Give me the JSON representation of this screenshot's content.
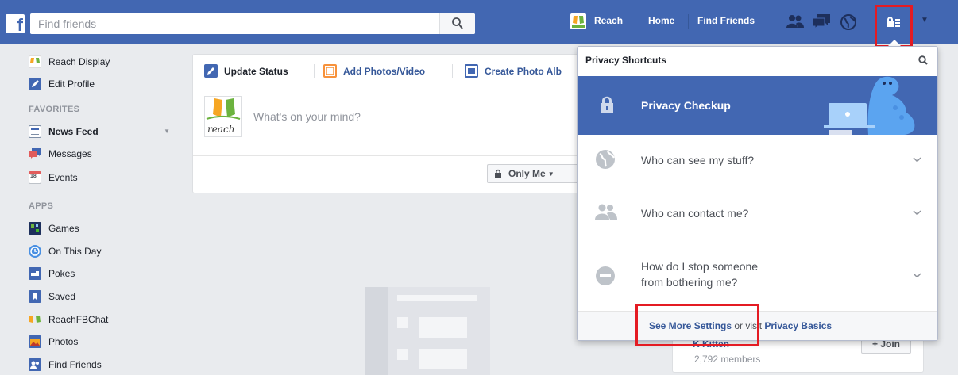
{
  "topbar": {
    "logo_letter": "f",
    "search_placeholder": "Find friends",
    "nav": {
      "profile_label": "Reach",
      "home_label": "Home",
      "find_friends_label": "Find Friends"
    },
    "icons": [
      "friend-requests-icon",
      "messages-icon",
      "notifications-globe-icon",
      "privacy-shortcuts-icon",
      "account-menu-caret-icon"
    ],
    "brand_color": "#4267b2"
  },
  "sidebar": {
    "top_items": [
      {
        "label": "Reach Display",
        "icon": "reach-logo-icon"
      },
      {
        "label": "Edit Profile",
        "icon": "pencil-icon"
      }
    ],
    "favorites_heading": "FAVORITES",
    "favorites": [
      {
        "label": "News Feed",
        "icon": "news-feed-icon",
        "bold": true
      },
      {
        "label": "Messages",
        "icon": "messages-icon"
      },
      {
        "label": "Events",
        "icon": "calendar-icon",
        "badge": "18"
      }
    ],
    "apps_heading": "APPS",
    "apps": [
      {
        "label": "Games",
        "icon": "games-icon"
      },
      {
        "label": "On This Day",
        "icon": "clock-icon"
      },
      {
        "label": "Pokes",
        "icon": "poke-icon"
      },
      {
        "label": "Saved",
        "icon": "bookmark-icon"
      },
      {
        "label": "ReachFBChat",
        "icon": "reach-logo-icon"
      },
      {
        "label": "Photos",
        "icon": "photos-icon"
      },
      {
        "label": "Find Friends",
        "icon": "find-friends-icon"
      }
    ]
  },
  "composer": {
    "tabs": [
      {
        "label": "Update Status",
        "icon": "pencil-icon"
      },
      {
        "label": "Add Photos/Video",
        "icon": "photo-icon"
      },
      {
        "label": "Create Photo Alb",
        "icon": "album-icon"
      }
    ],
    "avatar_text": "reach",
    "placeholder": "What's on your mind?",
    "audience_label": "Only Me"
  },
  "privacy_dropdown": {
    "title": "Privacy Shortcuts",
    "checkup_label": "Privacy Checkup",
    "rows": [
      {
        "text": "Who can see my stuff?",
        "icon": "globe-icon"
      },
      {
        "text": "Who can contact me?",
        "icon": "people-icon"
      },
      {
        "text_line1": "How do I stop someone",
        "text_line2": "from bothering me?",
        "icon": "block-icon"
      }
    ],
    "footer": {
      "see_more": "See More Settings",
      "middle": " or visit ",
      "basics": "Privacy Basics"
    }
  },
  "group_card": {
    "name_partial": "K Kitten",
    "members": "2,792 members",
    "join_label": "+ Join"
  },
  "highlight_color": "#e41b23"
}
